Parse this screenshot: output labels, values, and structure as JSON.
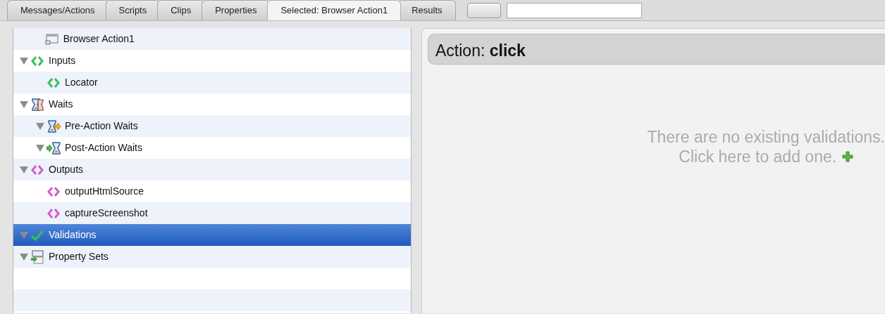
{
  "tabs": [
    {
      "label": "Messages/Actions",
      "selected": false
    },
    {
      "label": "Scripts",
      "selected": false
    },
    {
      "label": "Clips",
      "selected": false
    },
    {
      "label": "Properties",
      "selected": false
    },
    {
      "label": "Selected: Browser Action1",
      "selected": true
    },
    {
      "label": "Results",
      "selected": false
    }
  ],
  "tree": [
    {
      "kind": "action",
      "label": "Browser Action1",
      "selected": false
    },
    {
      "kind": "inputs",
      "label": "Inputs",
      "expanded": true,
      "selected": false,
      "children": [
        {
          "kind": "input",
          "label": "Locator",
          "selected": false
        }
      ]
    },
    {
      "kind": "waits",
      "label": "Waits",
      "expanded": true,
      "selected": false,
      "children": [
        {
          "kind": "pre-wait",
          "label": "Pre-Action Waits",
          "expanded": true,
          "selected": false
        },
        {
          "kind": "post-wait",
          "label": "Post-Action Waits",
          "expanded": true,
          "selected": false
        }
      ]
    },
    {
      "kind": "outputs",
      "label": "Outputs",
      "expanded": true,
      "selected": false,
      "children": [
        {
          "kind": "output",
          "label": "outputHtmlSource",
          "selected": false
        },
        {
          "kind": "output",
          "label": "captureScreenshot",
          "selected": false
        }
      ]
    },
    {
      "kind": "validations",
      "label": "Validations",
      "expanded": true,
      "selected": true
    },
    {
      "kind": "property-sets",
      "label": "Property Sets",
      "expanded": true,
      "selected": false
    }
  ],
  "detail": {
    "title": "Action: **click**",
    "empty_message": "There are no existing validations.",
    "add_link": "Click here to add one."
  }
}
